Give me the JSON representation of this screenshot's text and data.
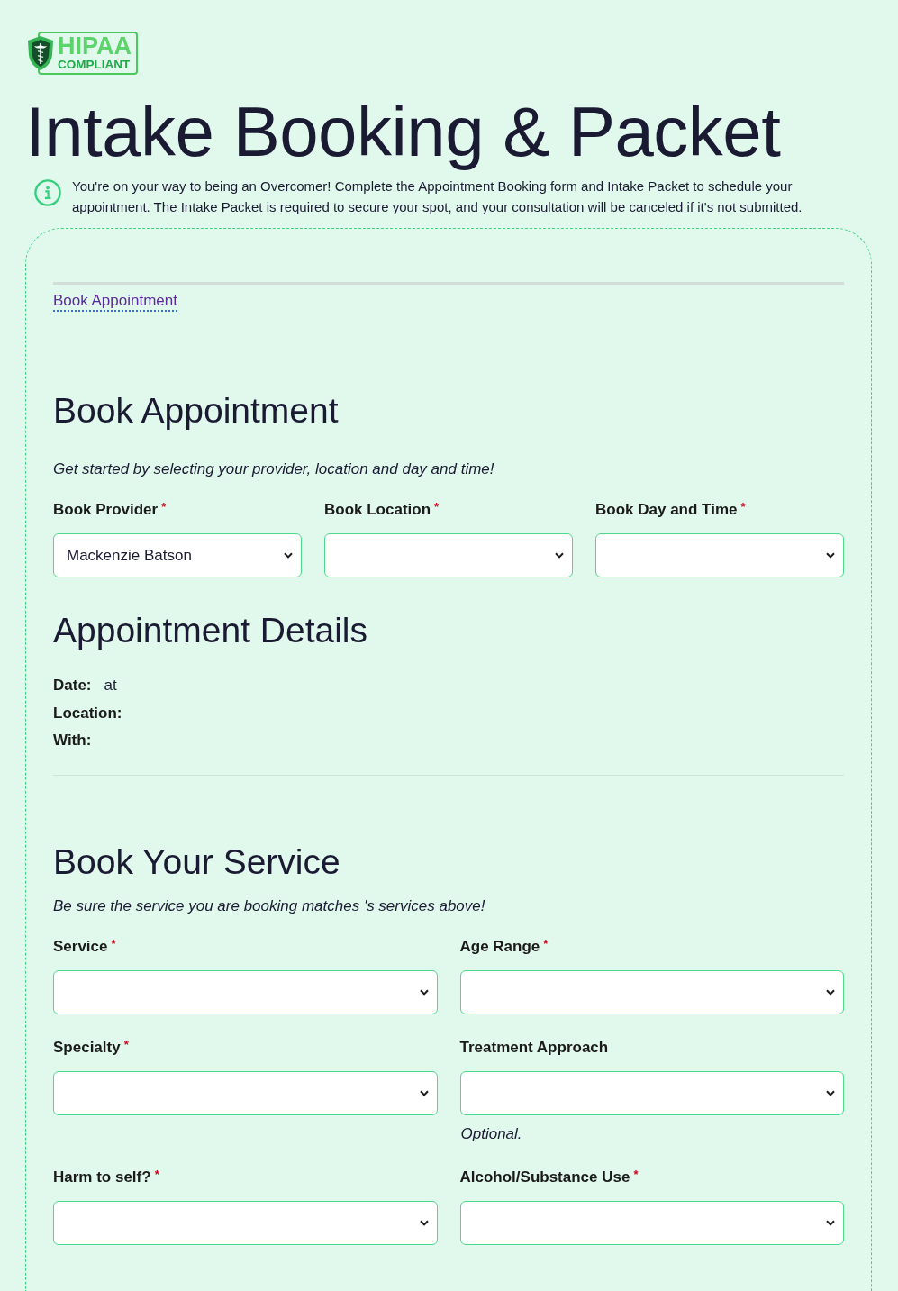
{
  "logo": {
    "title": "HIPAA",
    "subtitle": "COMPLIANT"
  },
  "title": "Intake Booking & Packet",
  "notice": "You're on your way to being an Overcomer! Complete the Appointment Booking form and Intake Packet to schedule your appointment. The Intake Packet is required to secure your spot, and your consultation will be canceled if it's not submitted.",
  "step_link": {
    "label": "Book Appointment"
  },
  "sections": [
    {
      "kind": "form",
      "heading": "Book Appointment",
      "intro": "Get started by selecting your provider, location and day and time!",
      "rows": [
        [
          {
            "label": "Book Provider",
            "required_mark": "*",
            "value": "Mackenzie Batson"
          },
          {
            "label": "Book Location",
            "required_mark": "*"
          },
          {
            "label": "Book Day and Time",
            "required_mark": "*"
          }
        ]
      ]
    },
    {
      "kind": "details",
      "heading": "Appointment Details",
      "details": [
        {
          "label": "Date:",
          "value": "at"
        },
        {
          "label": "Location:"
        },
        {
          "label": "With:"
        }
      ]
    },
    {
      "kind": "form",
      "heading": "Book Your Service",
      "intro": "Be sure the service you are booking matches 's services above!",
      "rows": [
        [
          {
            "label": "Service",
            "required_mark": "*"
          },
          {
            "label": "Age Range",
            "required_mark": "*"
          }
        ],
        [
          {
            "label": "Specialty",
            "required_mark": "*"
          },
          {
            "label": "Treatment Approach",
            "hint": "Optional."
          }
        ],
        [
          {
            "label": "Harm to self?",
            "required_mark": "*"
          },
          {
            "label": "Alcohol/Substance Use",
            "required_mark": "*"
          }
        ]
      ]
    }
  ]
}
